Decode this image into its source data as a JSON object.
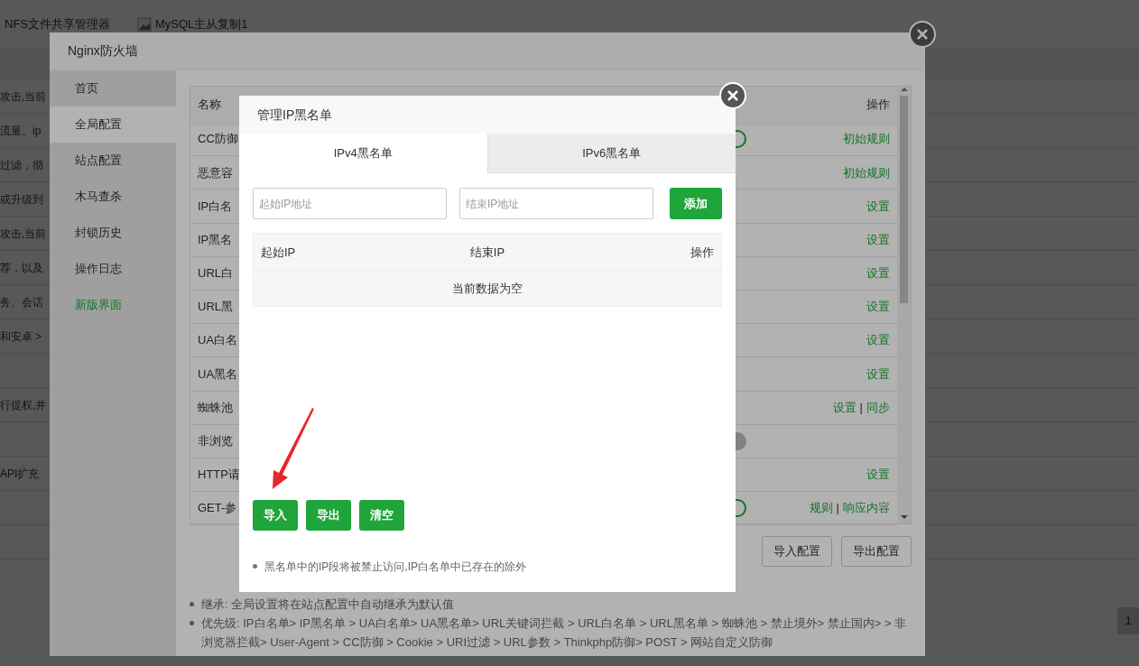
{
  "page": {
    "tabs": [
      {
        "label": "NFS文件共享管理器",
        "broken_image": false
      },
      {
        "label": "MySQL主从复制1",
        "broken_image": true
      }
    ],
    "rows": [
      {
        "text": "攻击,当前"
      },
      {
        "text": "流量、ip"
      },
      {
        "text": "过滤，彻"
      },
      {
        "text": "或升级到"
      },
      {
        "text": "攻击,当前"
      },
      {
        "text": "荐，以及"
      },
      {
        "text": "务、会话"
      },
      {
        "text": "和安卓",
        "link": ">"
      },
      {},
      {
        "text": "行提权,并"
      },
      {},
      {
        "text": "API扩充"
      },
      {},
      {}
    ],
    "pager": "1"
  },
  "firewall": {
    "title": "Nginx防火墙",
    "sidebar": [
      {
        "label": "首页",
        "selected": false,
        "highlight": false
      },
      {
        "label": "全局配置",
        "selected": true,
        "highlight": false
      },
      {
        "label": "站点配置",
        "selected": false,
        "highlight": false
      },
      {
        "label": "木马查杀",
        "selected": false,
        "highlight": false
      },
      {
        "label": "封锁历史",
        "selected": false,
        "highlight": false
      },
      {
        "label": "操作日志",
        "selected": false,
        "highlight": false
      },
      {
        "label": "新版界面",
        "selected": false,
        "highlight": true
      }
    ],
    "columns": [
      "名称",
      "操作"
    ],
    "rows": [
      {
        "name": "CC防御",
        "kind": "switch",
        "on": true,
        "actions": [
          "初始规则"
        ]
      },
      {
        "name": "恶意容",
        "kind": "plain",
        "actions": [
          "初始规则"
        ]
      },
      {
        "name": "IP白名",
        "kind": "plain",
        "actions": [
          "设置"
        ]
      },
      {
        "name": "IP黑名",
        "kind": "plain",
        "actions": [
          "设置"
        ]
      },
      {
        "name": "URL白",
        "kind": "plain",
        "actions": [
          "设置"
        ]
      },
      {
        "name": "URL黑",
        "kind": "plain",
        "actions": [
          "设置"
        ]
      },
      {
        "name": "UA白名",
        "kind": "plain",
        "actions": [
          "设置"
        ]
      },
      {
        "name": "UA黑名",
        "kind": "plain",
        "actions": [
          "设置"
        ]
      },
      {
        "name": "蜘蛛池",
        "kind": "plain",
        "actions": [
          "设置",
          "同步"
        ],
        "separator": "|"
      },
      {
        "name": "非浏览",
        "kind": "switch",
        "on": false,
        "actions": []
      },
      {
        "name": "HTTP请",
        "kind": "plain",
        "actions": [
          "设置"
        ]
      },
      {
        "name": "GET-参",
        "kind": "switch",
        "on": true,
        "actions": [
          "规则",
          "响应内容"
        ],
        "separator": "|"
      }
    ],
    "buttons": [
      "导入配置",
      "导出配置"
    ],
    "notes": [
      "继承: 全局设置将在站点配置中自动继承为默认值",
      "优先级: IP白名单> IP黑名单 > UA白名单> UA黑名单> URL关键词拦截 > URL白名单 > URL黑名单 > 蜘蛛池 > 禁止境外> 禁止国内> > 非浏览器拦截> User-Agent > CC防御 > Cookie > URI过滤 > URL参数 > Thinkphp防御> POST > 网站自定义防御"
    ]
  },
  "dialog": {
    "title": "管理IP黑名单",
    "tabs": [
      {
        "label": "IPv4黑名单",
        "selected": true
      },
      {
        "label": "IPv6黑名单",
        "selected": false
      }
    ],
    "start_field": {
      "placeholder": "起始IP地址"
    },
    "end_field": {
      "placeholder": "结束IP地址"
    },
    "add_button": "添加",
    "columns": [
      "起始IP",
      "结束IP",
      "操作"
    ],
    "empty_text": "当前数据为空",
    "buttons": [
      "导入",
      "导出",
      "清空"
    ],
    "notes": [
      "黑名单中的IP段将被禁止访问,IP白名单中已存在的除外"
    ]
  }
}
